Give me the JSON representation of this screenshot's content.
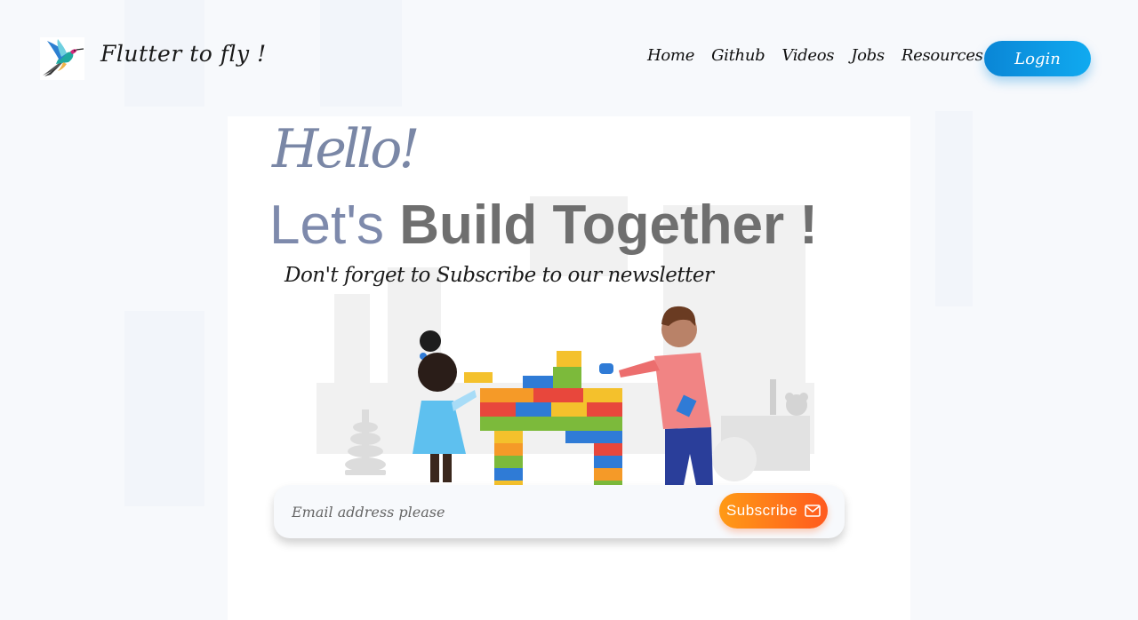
{
  "brand": {
    "name": "Flutter to fly !"
  },
  "nav": {
    "items": [
      {
        "label": "Home"
      },
      {
        "label": "Github"
      },
      {
        "label": "Videos"
      },
      {
        "label": "Jobs"
      },
      {
        "label": "Resources"
      }
    ],
    "login_label": "Login"
  },
  "hero": {
    "greeting": "Hello!",
    "headline_light": "Let's",
    "headline_bold": "Build Together !",
    "tagline": "Don't forget to Subscribe to our newsletter"
  },
  "subscribe": {
    "placeholder": "Email address please",
    "button_label": "Subscribe",
    "button_icon": "mail-icon"
  },
  "colors": {
    "accent_blue": "#0a86d6",
    "accent_orange": "#ff7a1a",
    "headline_light": "#7e8aac",
    "headline_bold": "#6f6f6f"
  }
}
